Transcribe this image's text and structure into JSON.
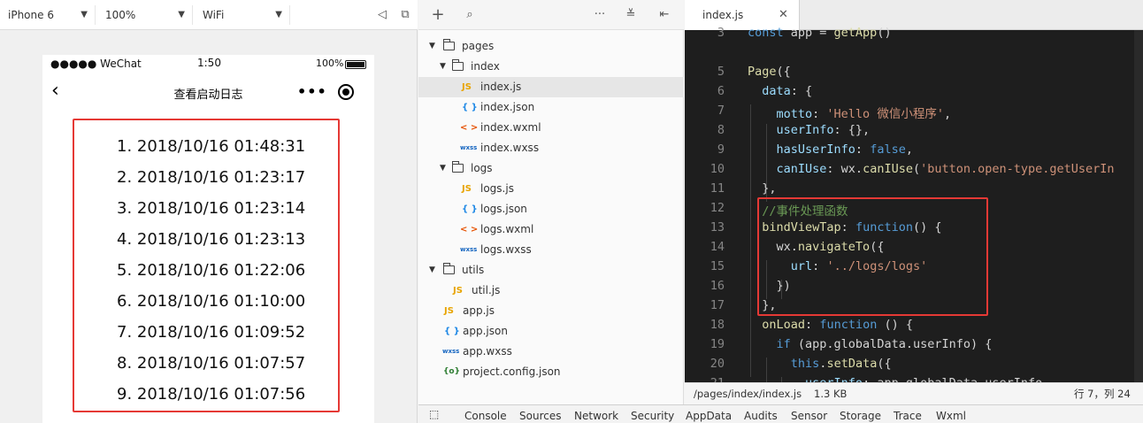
{
  "simulator": {
    "device": "iPhone 6",
    "zoom": "100%",
    "network": "WiFi",
    "status_bar": {
      "carrier": "●●●●● WeChat",
      "time": "1:50",
      "battery": "100%"
    },
    "nav_title": "查看启动日志",
    "logs": [
      "1. 2018/10/16 01:48:31",
      "2. 2018/10/16 01:23:17",
      "3. 2018/10/16 01:23:14",
      "4. 2018/10/16 01:23:13",
      "5. 2018/10/16 01:22:06",
      "6. 2018/10/16 01:10:00",
      "7. 2018/10/16 01:09:52",
      "8. 2018/10/16 01:07:57",
      "9. 2018/10/16 01:07:56"
    ]
  },
  "tree": {
    "items": [
      {
        "label": "pages",
        "type": "folder",
        "icon": "folder-icon"
      },
      {
        "label": "index",
        "type": "folder",
        "icon": "folder-icon"
      },
      {
        "label": "index.js",
        "type": "js",
        "icon": "JS"
      },
      {
        "label": "index.json",
        "type": "json",
        "icon": "{ }"
      },
      {
        "label": "index.wxml",
        "type": "wxml",
        "icon": "< >"
      },
      {
        "label": "index.wxss",
        "type": "wxss",
        "icon": "wxss"
      },
      {
        "label": "logs",
        "type": "folder",
        "icon": "folder-icon"
      },
      {
        "label": "logs.js",
        "type": "js",
        "icon": "JS"
      },
      {
        "label": "logs.json",
        "type": "json",
        "icon": "{ }"
      },
      {
        "label": "logs.wxml",
        "type": "wxml",
        "icon": "< >"
      },
      {
        "label": "logs.wxss",
        "type": "wxss",
        "icon": "wxss"
      },
      {
        "label": "utils",
        "type": "folder",
        "icon": "folder-icon"
      },
      {
        "label": "util.js",
        "type": "js",
        "icon": "JS"
      },
      {
        "label": "app.js",
        "type": "js",
        "icon": "JS"
      },
      {
        "label": "app.json",
        "type": "json",
        "icon": "{ }"
      },
      {
        "label": "app.wxss",
        "type": "wxss",
        "icon": "wxss"
      },
      {
        "label": "project.config.json",
        "type": "cfg",
        "icon": "{o}"
      }
    ]
  },
  "editor": {
    "tab_label": "index.js",
    "tab_close": "✕",
    "lines": [
      {
        "n": "3",
        "text": "const app = getApp()"
      },
      {
        "n": "4",
        "text": ""
      },
      {
        "n": "5",
        "text": "Page({"
      },
      {
        "n": "6",
        "text": "  data: {"
      },
      {
        "n": "7",
        "text": "    motto: 'Hello 微信小程序',"
      },
      {
        "n": "8",
        "text": "    userInfo: {},"
      },
      {
        "n": "9",
        "text": "    hasUserInfo: false,"
      },
      {
        "n": "10",
        "text": "    canIUse: wx.canIUse('button.open-type.getUserIn"
      },
      {
        "n": "11",
        "text": "  },"
      },
      {
        "n": "12",
        "text": "  //事件处理函数"
      },
      {
        "n": "13",
        "text": "  bindViewTap: function() {"
      },
      {
        "n": "14",
        "text": "    wx.navigateTo({"
      },
      {
        "n": "15",
        "text": "      url: '../logs/logs'"
      },
      {
        "n": "16",
        "text": "    })"
      },
      {
        "n": "17",
        "text": "  },"
      },
      {
        "n": "18",
        "text": "  onLoad: function () {"
      },
      {
        "n": "19",
        "text": "    if (app.globalData.userInfo) {"
      },
      {
        "n": "20",
        "text": "      this.setData({"
      },
      {
        "n": "21",
        "text": "        userInfo: app.globalData.userInfo,"
      }
    ],
    "status": {
      "path": "/pages/index/index.js",
      "size": "1.3 KB",
      "position": "行 7，列 24"
    }
  },
  "devtools_tabs": [
    "Console",
    "Sources",
    "Network",
    "Security",
    "AppData",
    "Audits",
    "Sensor",
    "Storage",
    "Trace",
    "Wxml"
  ],
  "colors": {
    "highlight_box": "#e53935",
    "editor_bg": "#1e1e1e"
  }
}
